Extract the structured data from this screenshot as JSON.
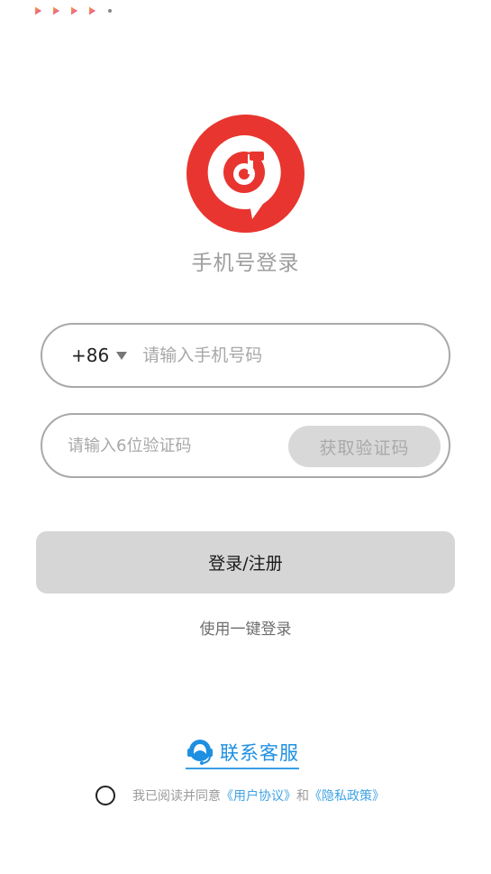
{
  "status_bar": {
    "notification_icons": [
      "play-notification-icon",
      "play-notification-icon",
      "play-notification-icon",
      "play-notification-icon"
    ]
  },
  "colors": {
    "brand": "#e8352f",
    "link": "#3fa2e4",
    "support": "#1f8fe0",
    "button_disabled": "#d6d6d6"
  },
  "header": {
    "title": "手机号登录"
  },
  "phone_field": {
    "country_code": "+86",
    "placeholder": "请输入手机号码",
    "value": ""
  },
  "code_field": {
    "placeholder": "请输入6位验证码",
    "value": "",
    "get_code_label": "获取验证码"
  },
  "login_button": {
    "label": "登录/注册"
  },
  "one_key_login": {
    "label": "使用一键登录"
  },
  "support": {
    "label": "联系客服"
  },
  "agreement": {
    "checked": false,
    "prefix": "我已阅读并同意",
    "user_agreement": "《用户协议》",
    "conjunction": "和",
    "privacy_policy": "《隐私政策》"
  }
}
